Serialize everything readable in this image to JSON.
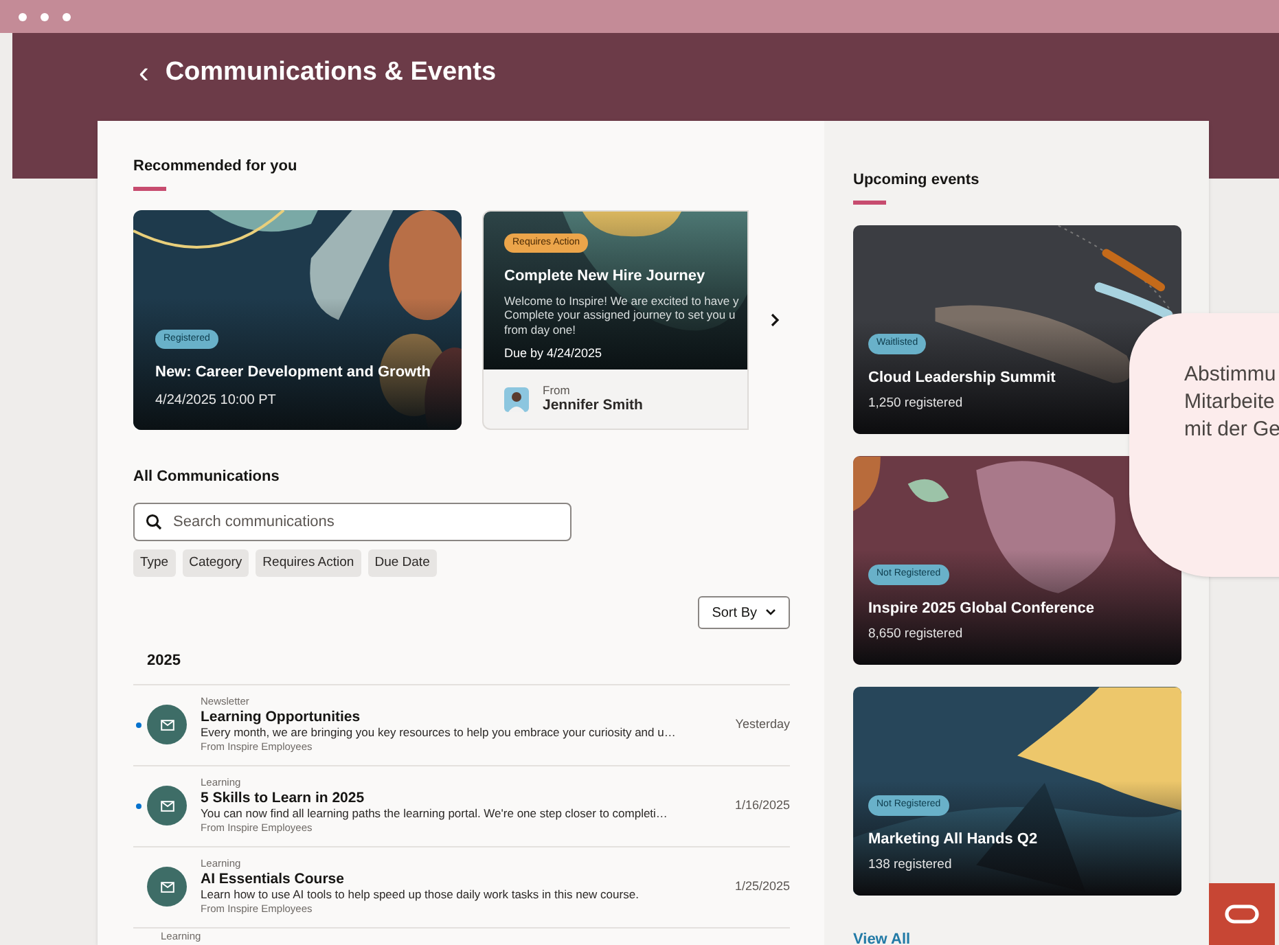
{
  "header": {
    "back_icon": "‹",
    "title": "Communications & Events"
  },
  "recommended": {
    "title": "Recommended for you",
    "cards": [
      {
        "kind": "event",
        "badge": "Registered",
        "title": "New: Career Development and Growth",
        "date": "4/24/2025 10:00 PT"
      },
      {
        "kind": "task",
        "badge": "Requires Action",
        "title": "Complete New Hire Journey",
        "body": "Welcome to Inspire! We are excited to have y Complete your assigned journey to set you u from day one!",
        "due": "Due by 4/24/2025",
        "from_label": "From",
        "from_name": "Jennifer Smith"
      }
    ]
  },
  "all_communications": {
    "title": "All Communications",
    "search": {
      "placeholder": "Search communications"
    },
    "filters": [
      "Type",
      "Category",
      "Requires Action",
      "Due Date"
    ],
    "sort": "Sort By",
    "year": "2025",
    "items": [
      {
        "category": "Newsletter",
        "title": "Learning Opportunities",
        "body": "Every month, we are bringing you key resources to help you embrace your curiosity and u…",
        "from": "From Inspire Employees",
        "date": "Yesterday",
        "unread": true
      },
      {
        "category": "Learning",
        "title": "5 Skills to Learn in 2025",
        "body": "You can now find all learning paths the learning portal. We're one step closer to completi…",
        "from": "From Inspire Employees",
        "date": "1/16/2025",
        "unread": true
      },
      {
        "category": "Learning",
        "title": "AI Essentials Course",
        "body": "Learn how to use AI tools to help speed up those daily work tasks in this new course.",
        "from": "From Inspire Employees",
        "date": "1/25/2025",
        "unread": false
      },
      {
        "category": "Learning",
        "unread": false
      }
    ]
  },
  "upcoming_events": {
    "title": "Upcoming events",
    "events": [
      {
        "badge": "Waitlisted",
        "title": "Cloud Leadership Summit",
        "registered": "1,250 registered"
      },
      {
        "badge": "Not Registered",
        "title": "Inspire 2025 Global Conference",
        "registered": "8,650 registered"
      },
      {
        "badge": "Not Registered",
        "title": "Marketing All Hands Q2",
        "registered": "138 registered"
      }
    ],
    "view_all": "View All"
  },
  "speech_bubble": {
    "lines": [
      "Abstimmu",
      "Mitarbeite",
      "mit der Ge"
    ]
  }
}
